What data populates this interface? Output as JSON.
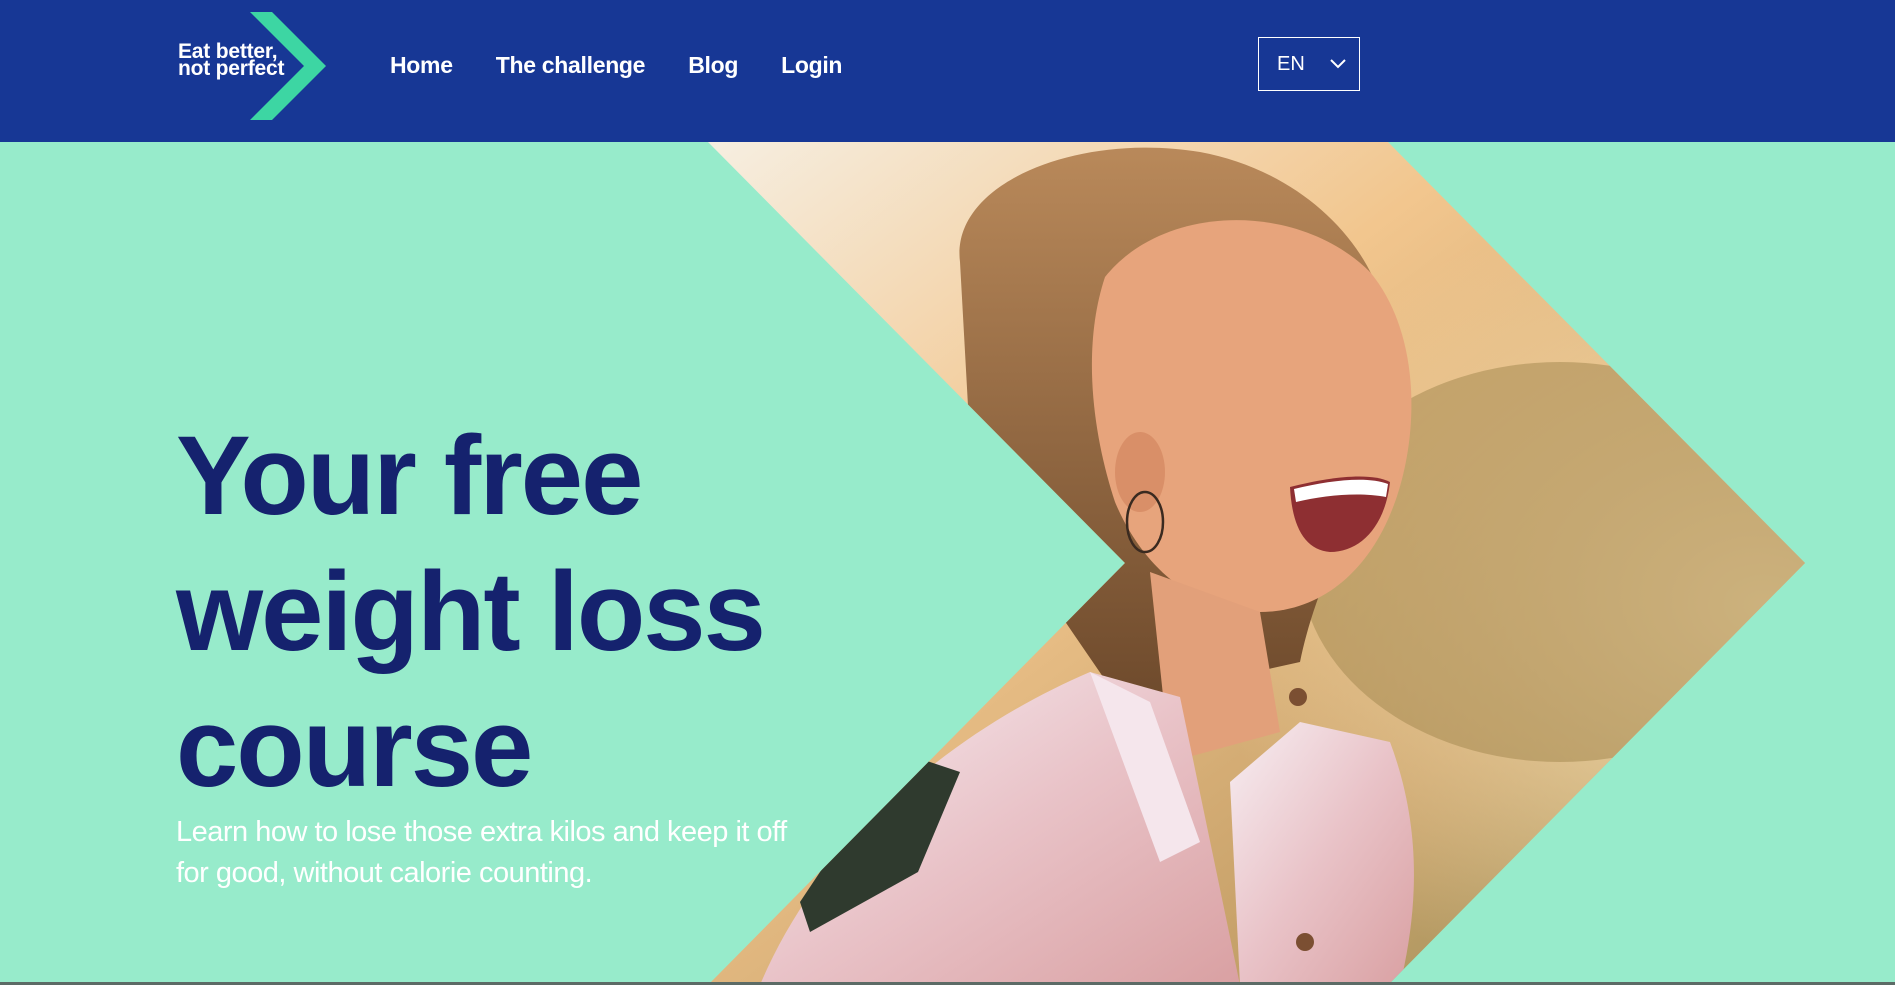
{
  "header": {
    "logo": {
      "line1": "Eat better,",
      "line2": "not perfect"
    },
    "nav": [
      {
        "label": "Home"
      },
      {
        "label": "The challenge"
      },
      {
        "label": "Blog"
      },
      {
        "label": "Login"
      }
    ],
    "language": {
      "selected": "EN",
      "icon": "chevron-down-icon"
    }
  },
  "hero": {
    "title_lines": [
      "Your free",
      "weight loss",
      "course"
    ],
    "subtitle_lines": [
      "Learn how to lose those extra kilos and keep it off",
      "for good, without calorie counting."
    ],
    "image": "smiling-woman-photo"
  },
  "colors": {
    "header_bg": "#173795",
    "hero_bg": "#97ebcb",
    "title": "#15226e",
    "logo_arrow": "#3dd6a3",
    "text_light": "#ffffff"
  }
}
